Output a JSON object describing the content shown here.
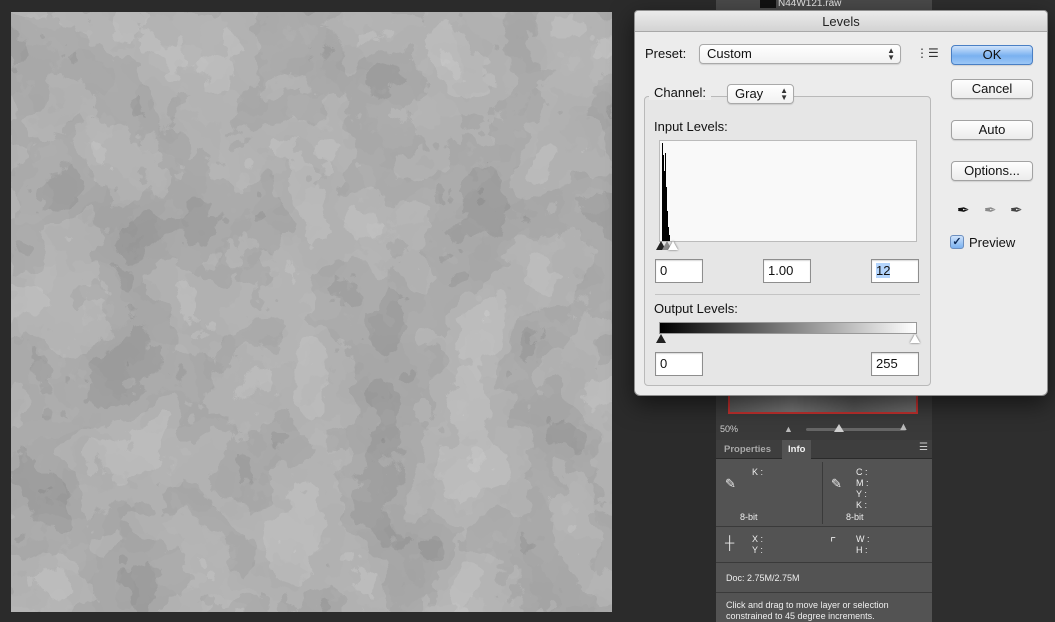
{
  "dialog": {
    "title": "Levels",
    "preset_label": "Preset:",
    "preset_value": "Custom",
    "channel_label": "Channel:",
    "channel_value": "Gray",
    "input_levels_label": "Input Levels:",
    "input_black": "0",
    "input_gamma": "1.00",
    "input_white": "12",
    "output_levels_label": "Output Levels:",
    "output_black": "0",
    "output_white": "255",
    "buttons": {
      "ok": "OK",
      "cancel": "Cancel",
      "auto": "Auto",
      "options": "Options..."
    },
    "preview_label": "Preview",
    "preview_checked": true
  },
  "layers_panel": {
    "layer_name": "N44W121.raw"
  },
  "navigator": {
    "zoom": "50%"
  },
  "info_panel": {
    "tabs": [
      "Properties",
      "Info"
    ],
    "active_tab": "Info",
    "left_channel": "K :",
    "right_channels": [
      "C :",
      "M :",
      "Y :",
      "K :"
    ],
    "left_bitdepth": "8-bit",
    "right_bitdepth": "8-bit",
    "xy": [
      "X :",
      "Y :"
    ],
    "wh": [
      "W :",
      "H :"
    ],
    "doc_size": "Doc: 2.75M/2.75M",
    "hint": "Click and drag to move layer or selection constrained to 45 degree increments."
  },
  "colors": {
    "accent_button": "#7ab1f0",
    "navigator_frame": "#c0302e"
  }
}
